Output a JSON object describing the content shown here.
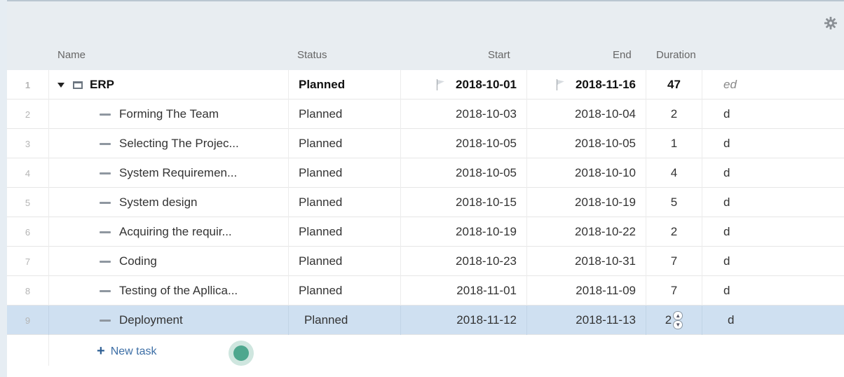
{
  "columns": {
    "name": "Name",
    "status": "Status",
    "start": "Start",
    "end": "End",
    "duration": "Duration"
  },
  "icons": {
    "settings": "gear-icon",
    "collapse": "caret-down-icon",
    "folder": "folder-icon",
    "task": "task-bar-icon",
    "flag": "flag-icon",
    "add": "plus-icon"
  },
  "colors": {
    "selected_row": "#cfe0f1",
    "header_band": "#e8edf1",
    "link": "#3d6fa6",
    "cursor": "#4ea78e"
  },
  "summary": {
    "num": "1",
    "name": "ERP",
    "status": "Planned",
    "start": "2018-10-01",
    "end": "2018-11-16",
    "duration": "47",
    "unit": "ed"
  },
  "tasks": [
    {
      "num": "2",
      "name": "Forming The Team",
      "status": "Planned",
      "start": "2018-10-03",
      "end": "2018-10-04",
      "duration": "2",
      "unit": "d"
    },
    {
      "num": "3",
      "name": "Selecting The Projec...",
      "status": "Planned",
      "start": "2018-10-05",
      "end": "2018-10-05",
      "duration": "1",
      "unit": "d"
    },
    {
      "num": "4",
      "name": "System Requiremen...",
      "status": "Planned",
      "start": "2018-10-05",
      "end": "2018-10-10",
      "duration": "4",
      "unit": "d"
    },
    {
      "num": "5",
      "name": "System design",
      "status": "Planned",
      "start": "2018-10-15",
      "end": "2018-10-19",
      "duration": "5",
      "unit": "d"
    },
    {
      "num": "6",
      "name": "Acquiring the requir...",
      "status": "Planned",
      "start": "2018-10-19",
      "end": "2018-10-22",
      "duration": "2",
      "unit": "d"
    },
    {
      "num": "7",
      "name": "Coding",
      "status": "Planned",
      "start": "2018-10-23",
      "end": "2018-10-31",
      "duration": "7",
      "unit": "d"
    },
    {
      "num": "8",
      "name": "Testing of the Apllica...",
      "status": "Planned",
      "start": "2018-11-01",
      "end": "2018-11-09",
      "duration": "7",
      "unit": "d"
    },
    {
      "num": "9",
      "name": "Deployment",
      "status": "Planned",
      "start": "2018-11-12",
      "end": "2018-11-13",
      "duration": "2",
      "unit": "d"
    }
  ],
  "new_task_label": "New task"
}
